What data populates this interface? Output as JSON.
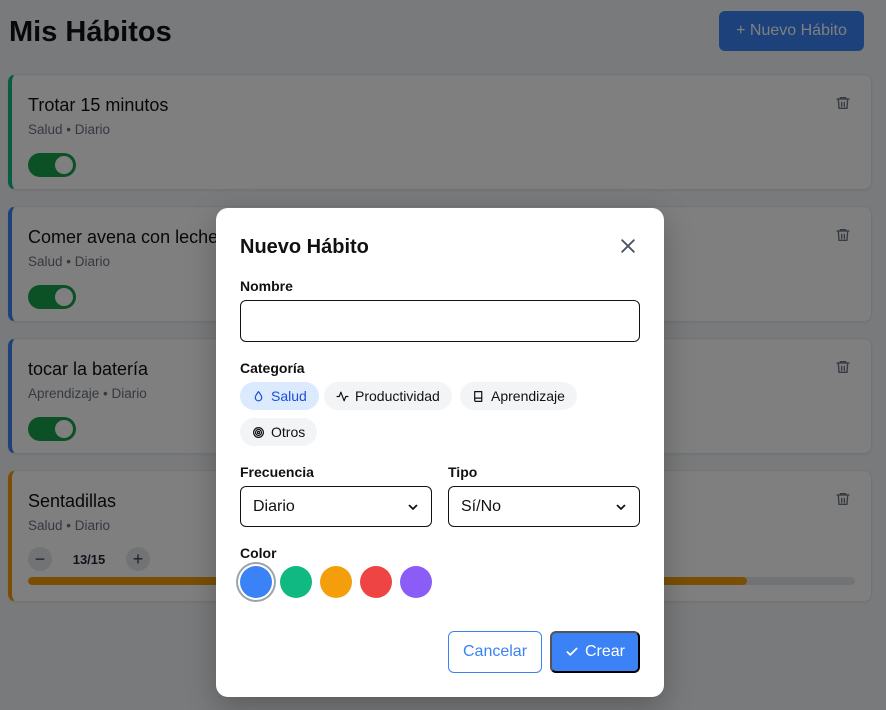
{
  "header": {
    "title": "Mis Hábitos",
    "new_button": "+ Nuevo Hábito"
  },
  "habits": [
    {
      "name": "Trotar 15 minutos",
      "meta": "Salud • Diario",
      "color": "#10b981",
      "type": "toggle",
      "done": true
    },
    {
      "name": "Comer avena con leche",
      "meta": "Salud • Diario",
      "color": "#3b82f6",
      "type": "toggle",
      "done": true
    },
    {
      "name": "tocar la batería",
      "meta": "Aprendizaje • Diario",
      "color": "#3b82f6",
      "type": "toggle",
      "done": true
    },
    {
      "name": "Sentadillas",
      "meta": "Salud • Diario",
      "color": "#f59e0b",
      "type": "counter",
      "count_label": "13/15",
      "progress": 0.87
    }
  ],
  "modal": {
    "title": "Nuevo Hábito",
    "name_label": "Nombre",
    "name_value": "",
    "category_label": "Categoría",
    "categories": [
      {
        "label": "Salud",
        "icon": "droplet-icon",
        "active": true
      },
      {
        "label": "Productividad",
        "icon": "activity-icon",
        "active": false
      },
      {
        "label": "Aprendizaje",
        "icon": "book-icon",
        "active": false
      },
      {
        "label": "Otros",
        "icon": "target-icon",
        "active": false
      }
    ],
    "frequency_label": "Frecuencia",
    "frequency_value": "Diario",
    "type_label": "Tipo",
    "type_value": "Sí/No",
    "color_label": "Color",
    "colors": [
      "#3b82f6",
      "#10b981",
      "#f59e0b",
      "#ef4444",
      "#8b5cf6"
    ],
    "selected_color": "#3b82f6",
    "cancel_label": "Cancelar",
    "create_label": "Crear"
  }
}
